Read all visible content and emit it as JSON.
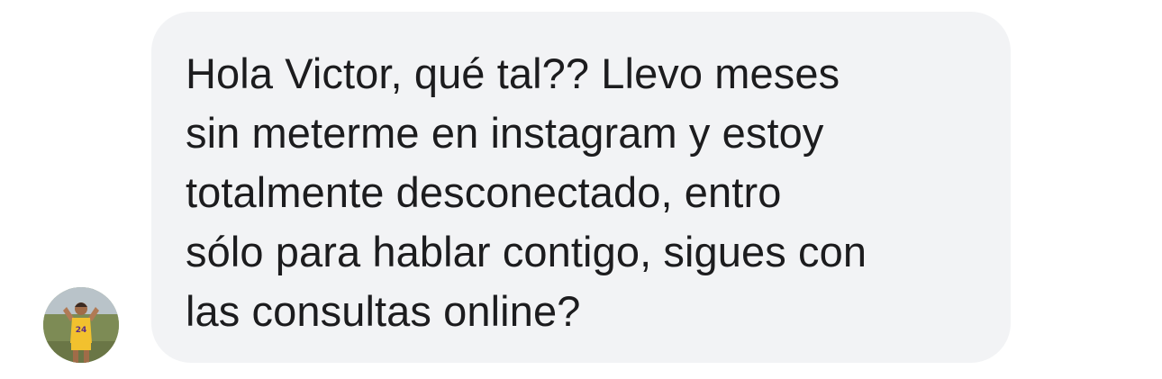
{
  "conversation": {
    "incoming_message": {
      "text": "Hola Victor, qué tal?? Llevo meses\nsin meterme en instagram y estoy\ntotalmente desconectado, entro\nsólo para hablar contigo, sigues con\nlas consultas online?"
    }
  },
  "colors": {
    "bubble_background": "#f2f3f5",
    "message_text": "#1c1c1e",
    "page_background": "#ffffff"
  },
  "icons": {
    "avatar": "sender-avatar"
  }
}
